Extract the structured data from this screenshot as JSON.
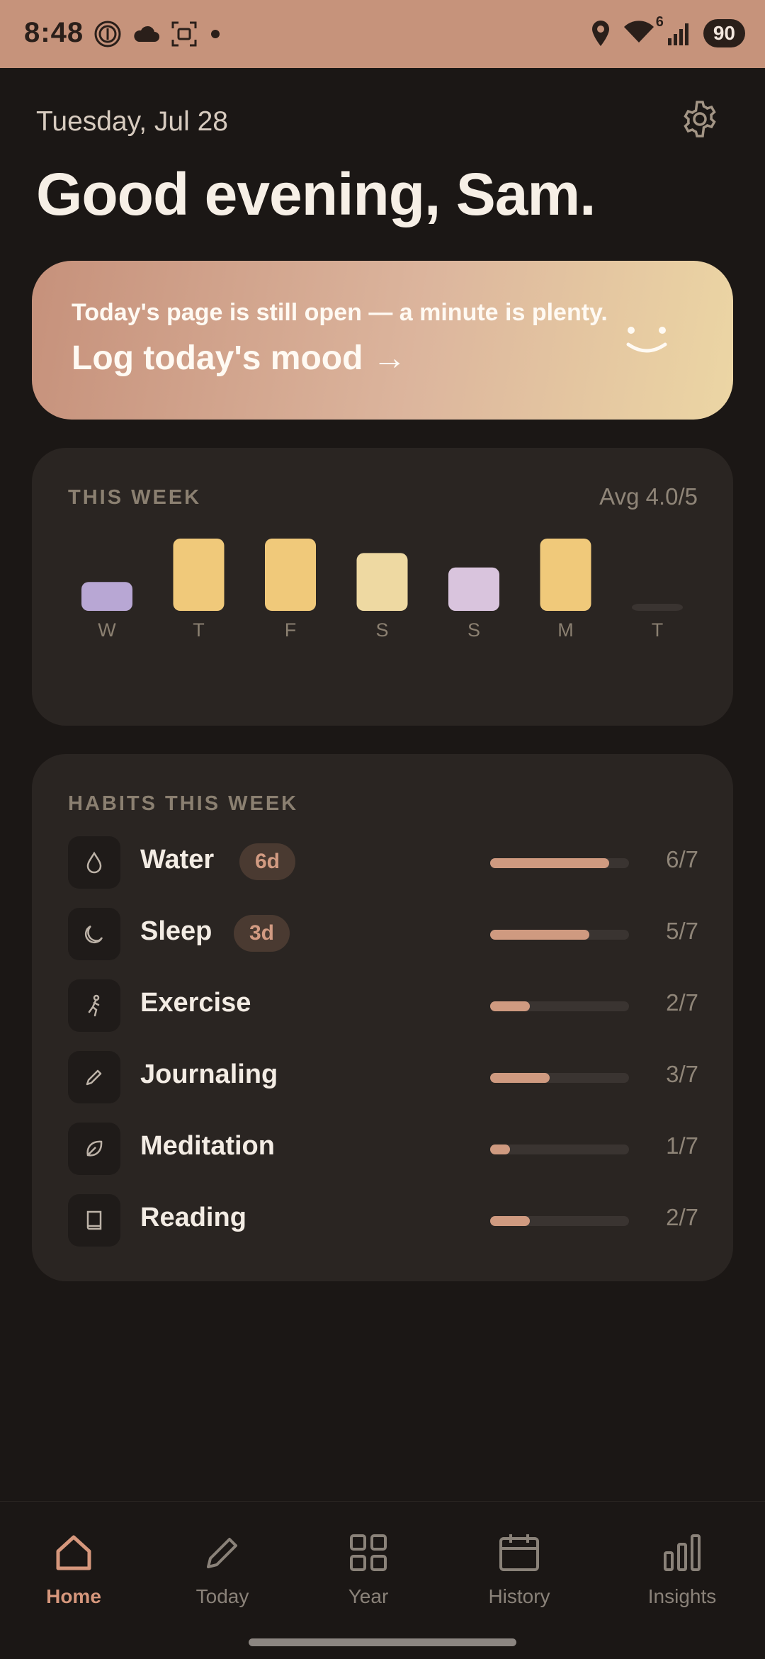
{
  "status_bar": {
    "time": "8:48",
    "battery": "90",
    "wifi_badge": "6"
  },
  "header": {
    "date": "Tuesday, Jul 28",
    "greeting": "Good evening, Sam."
  },
  "banner": {
    "subtitle": "Today's page is still open — a minute is plenty.",
    "cta": "Log today's mood →"
  },
  "week": {
    "title": "THIS WEEK",
    "avg": "Avg 4.0/5",
    "chart_data": {
      "type": "bar",
      "categories": [
        "W",
        "T",
        "F",
        "S",
        "S",
        "M",
        "T"
      ],
      "values": [
        2,
        5,
        5,
        4,
        3,
        5,
        null
      ],
      "ylim": [
        0,
        5
      ],
      "colors": [
        "#b8a7d4",
        "#f0c97a",
        "#f0c97a",
        "#eed9a2",
        "#d9c4dd",
        "#f0c97a",
        "#3a3431"
      ]
    }
  },
  "habits": {
    "title": "HABITS THIS WEEK",
    "items": [
      {
        "name": "Water",
        "icon": "water-drop-icon",
        "streak": "6d",
        "count": "6/7",
        "progress": 0.857
      },
      {
        "name": "Sleep",
        "icon": "moon-icon",
        "streak": "3d",
        "count": "5/7",
        "progress": 0.714
      },
      {
        "name": "Exercise",
        "icon": "running-person-icon",
        "streak": "",
        "count": "2/7",
        "progress": 0.286
      },
      {
        "name": "Journaling",
        "icon": "pencil-icon",
        "streak": "",
        "count": "3/7",
        "progress": 0.429
      },
      {
        "name": "Meditation",
        "icon": "leaf-icon",
        "streak": "",
        "count": "1/7",
        "progress": 0.143
      },
      {
        "name": "Reading",
        "icon": "book-icon",
        "streak": "",
        "count": "2/7",
        "progress": 0.286
      }
    ]
  },
  "nav": {
    "items": [
      {
        "label": "Home",
        "icon": "home-icon",
        "active": true
      },
      {
        "label": "Today",
        "icon": "pencil-icon",
        "active": false
      },
      {
        "label": "Year",
        "icon": "grid-icon",
        "active": false
      },
      {
        "label": "History",
        "icon": "calendar-icon",
        "active": false
      },
      {
        "label": "Insights",
        "icon": "bar-chart-icon",
        "active": false
      }
    ]
  },
  "colors": {
    "accent": "#cf9a80",
    "background": "#1b1715",
    "card": "#2a2522"
  }
}
